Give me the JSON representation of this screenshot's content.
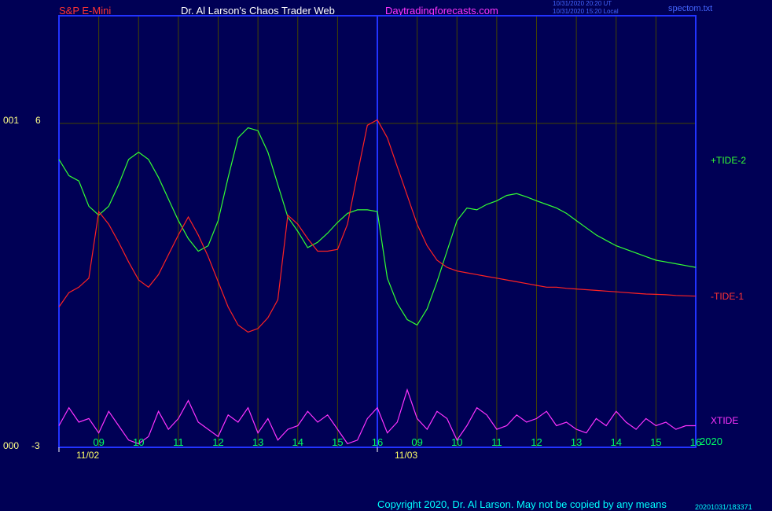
{
  "header": {
    "symbol": "S&P E-Mini",
    "title": "Dr. Al Larson's Chaos Trader Web",
    "website": "Daytradingforecasts.com",
    "time_ut": "10/31/2020 20:20 UT",
    "time_local": "10/31/2020 15:20 Local",
    "file": "spectom.txt"
  },
  "axis": {
    "y_top_prefix": "001",
    "y_top_value": "6",
    "y_bottom_prefix": "000",
    "y_bottom_value": "-3",
    "year": "2020"
  },
  "footer": {
    "copyright": "Copyright 2020, Dr. Al Larson. May not be copied by any means",
    "id": "20201031/183371"
  },
  "colors": {
    "background": "#000055",
    "frame": "#2233ff",
    "grid": "#444400",
    "tide1": "#ff2222",
    "tide2": "#33ff33",
    "xtide": "#ff33ff",
    "hour_label": "#00ff66",
    "date_label": "#ffff66"
  },
  "chart_data": {
    "type": "line",
    "title": "S&P E-Mini",
    "ylim": [
      -3,
      6
    ],
    "y_ticks": [
      6,
      -3
    ],
    "x_tick_labels": [
      "09",
      "10",
      "11",
      "12",
      "13",
      "14",
      "15",
      "16",
      "09",
      "10",
      "11",
      "12",
      "13",
      "14",
      "15",
      "16"
    ],
    "date_labels": [
      "11/02",
      "11/03"
    ],
    "x": [
      0,
      0.25,
      0.5,
      0.75,
      1,
      1.25,
      1.5,
      1.75,
      2,
      2.25,
      2.5,
      2.75,
      3,
      3.25,
      3.5,
      3.75,
      4,
      4.25,
      4.5,
      4.75,
      5,
      5.25,
      5.5,
      5.75,
      6,
      6.25,
      6.5,
      6.75,
      7,
      7.25,
      7.5,
      7.75,
      8,
      8.25,
      8.5,
      8.75,
      9,
      9.25,
      9.5,
      9.75,
      10,
      10.25,
      10.5,
      10.75,
      11,
      11.25,
      11.5,
      11.75,
      12,
      12.25,
      12.5,
      12.75,
      13,
      13.25,
      13.5,
      13.75,
      14,
      14.25,
      14.5,
      14.75,
      15,
      15.25,
      15.5,
      15.75,
      16
    ],
    "series": [
      {
        "name": "+TIDE-2",
        "values": [
          5.0,
          4.55,
          4.4,
          3.7,
          3.45,
          3.7,
          4.3,
          5.0,
          5.2,
          5.0,
          4.5,
          3.9,
          3.3,
          2.8,
          2.45,
          2.6,
          3.3,
          4.5,
          5.6,
          5.88,
          5.8,
          5.2,
          4.3,
          3.4,
          3.0,
          2.55,
          2.7,
          2.95,
          3.25,
          3.5,
          3.6,
          3.6,
          3.55,
          1.7,
          1.0,
          0.55,
          0.4,
          0.85,
          1.6,
          2.45,
          3.3,
          3.65,
          3.6,
          3.75,
          3.85,
          4.0,
          4.05,
          3.96,
          3.85,
          3.75,
          3.65,
          3.5,
          3.3,
          3.1,
          2.9,
          2.75,
          2.6,
          2.5,
          2.4,
          2.3,
          2.2,
          2.15,
          2.1,
          2.05,
          2.0
        ]
      },
      {
        "name": "-TIDE-1",
        "values": [
          0.9,
          1.3,
          1.45,
          1.7,
          3.55,
          3.2,
          2.7,
          2.15,
          1.65,
          1.45,
          1.8,
          2.35,
          2.9,
          3.4,
          2.9,
          2.3,
          1.6,
          0.9,
          0.4,
          0.2,
          0.3,
          0.6,
          1.1,
          3.45,
          3.2,
          2.8,
          2.45,
          2.45,
          2.5,
          3.2,
          4.6,
          5.95,
          6.1,
          5.6,
          4.8,
          4.0,
          3.2,
          2.6,
          2.2,
          2.0,
          1.9,
          1.85,
          1.8,
          1.75,
          1.7,
          1.65,
          1.6,
          1.55,
          1.5,
          1.45,
          1.45,
          1.42,
          1.4,
          1.38,
          1.36,
          1.34,
          1.32,
          1.3,
          1.28,
          1.26,
          1.25,
          1.24,
          1.22,
          1.21,
          1.2
        ]
      },
      {
        "name": "XTIDE",
        "values": [
          -2.4,
          -1.9,
          -2.3,
          -2.2,
          -2.6,
          -2.0,
          -2.4,
          -2.8,
          -2.9,
          -2.7,
          -2.0,
          -2.5,
          -2.2,
          -1.7,
          -2.3,
          -2.5,
          -2.7,
          -2.1,
          -2.3,
          -1.9,
          -2.6,
          -2.2,
          -2.8,
          -2.5,
          -2.4,
          -2.0,
          -2.3,
          -2.1,
          -2.5,
          -2.9,
          -2.8,
          -2.2,
          -1.9,
          -2.6,
          -2.3,
          -1.4,
          -2.2,
          -2.5,
          -2.0,
          -2.2,
          -2.8,
          -2.4,
          -1.9,
          -2.1,
          -2.5,
          -2.4,
          -2.1,
          -2.3,
          -2.2,
          -2.0,
          -2.4,
          -2.3,
          -2.5,
          -2.6,
          -2.2,
          -2.4,
          -2.0,
          -2.3,
          -2.5,
          -2.2,
          -2.4,
          -2.3,
          -2.5,
          -2.4,
          -2.4
        ]
      }
    ]
  }
}
